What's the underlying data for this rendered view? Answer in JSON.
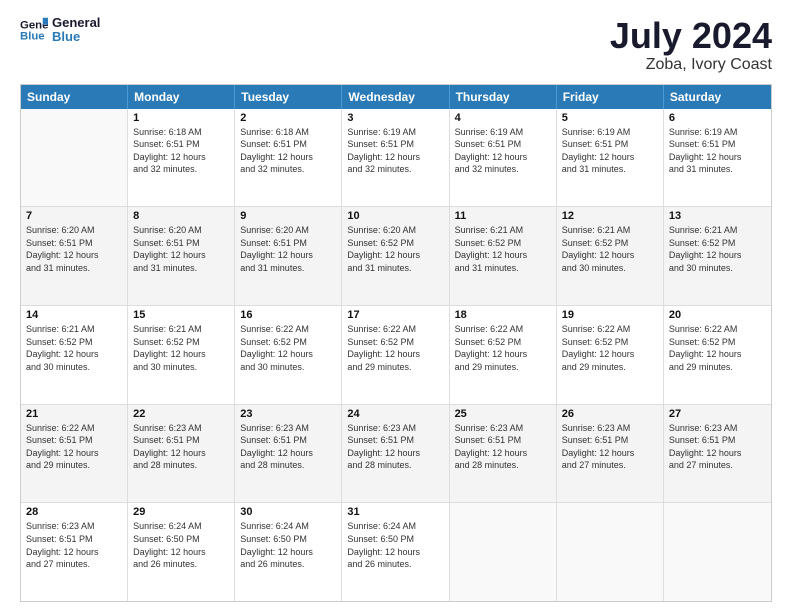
{
  "logo": {
    "line1": "General",
    "line2": "Blue"
  },
  "title": "July 2024",
  "subtitle": "Zoba, Ivory Coast",
  "header_days": [
    "Sunday",
    "Monday",
    "Tuesday",
    "Wednesday",
    "Thursday",
    "Friday",
    "Saturday"
  ],
  "weeks": [
    [
      {
        "day": "",
        "info": "",
        "empty": true
      },
      {
        "day": "1",
        "info": "Sunrise: 6:18 AM\nSunset: 6:51 PM\nDaylight: 12 hours\nand 32 minutes."
      },
      {
        "day": "2",
        "info": "Sunrise: 6:18 AM\nSunset: 6:51 PM\nDaylight: 12 hours\nand 32 minutes."
      },
      {
        "day": "3",
        "info": "Sunrise: 6:19 AM\nSunset: 6:51 PM\nDaylight: 12 hours\nand 32 minutes."
      },
      {
        "day": "4",
        "info": "Sunrise: 6:19 AM\nSunset: 6:51 PM\nDaylight: 12 hours\nand 32 minutes."
      },
      {
        "day": "5",
        "info": "Sunrise: 6:19 AM\nSunset: 6:51 PM\nDaylight: 12 hours\nand 31 minutes."
      },
      {
        "day": "6",
        "info": "Sunrise: 6:19 AM\nSunset: 6:51 PM\nDaylight: 12 hours\nand 31 minutes."
      }
    ],
    [
      {
        "day": "7",
        "info": "Sunrise: 6:20 AM\nSunset: 6:51 PM\nDaylight: 12 hours\nand 31 minutes."
      },
      {
        "day": "8",
        "info": "Sunrise: 6:20 AM\nSunset: 6:51 PM\nDaylight: 12 hours\nand 31 minutes."
      },
      {
        "day": "9",
        "info": "Sunrise: 6:20 AM\nSunset: 6:51 PM\nDaylight: 12 hours\nand 31 minutes."
      },
      {
        "day": "10",
        "info": "Sunrise: 6:20 AM\nSunset: 6:52 PM\nDaylight: 12 hours\nand 31 minutes."
      },
      {
        "day": "11",
        "info": "Sunrise: 6:21 AM\nSunset: 6:52 PM\nDaylight: 12 hours\nand 31 minutes."
      },
      {
        "day": "12",
        "info": "Sunrise: 6:21 AM\nSunset: 6:52 PM\nDaylight: 12 hours\nand 30 minutes."
      },
      {
        "day": "13",
        "info": "Sunrise: 6:21 AM\nSunset: 6:52 PM\nDaylight: 12 hours\nand 30 minutes."
      }
    ],
    [
      {
        "day": "14",
        "info": "Sunrise: 6:21 AM\nSunset: 6:52 PM\nDaylight: 12 hours\nand 30 minutes."
      },
      {
        "day": "15",
        "info": "Sunrise: 6:21 AM\nSunset: 6:52 PM\nDaylight: 12 hours\nand 30 minutes."
      },
      {
        "day": "16",
        "info": "Sunrise: 6:22 AM\nSunset: 6:52 PM\nDaylight: 12 hours\nand 30 minutes."
      },
      {
        "day": "17",
        "info": "Sunrise: 6:22 AM\nSunset: 6:52 PM\nDaylight: 12 hours\nand 29 minutes."
      },
      {
        "day": "18",
        "info": "Sunrise: 6:22 AM\nSunset: 6:52 PM\nDaylight: 12 hours\nand 29 minutes."
      },
      {
        "day": "19",
        "info": "Sunrise: 6:22 AM\nSunset: 6:52 PM\nDaylight: 12 hours\nand 29 minutes."
      },
      {
        "day": "20",
        "info": "Sunrise: 6:22 AM\nSunset: 6:52 PM\nDaylight: 12 hours\nand 29 minutes."
      }
    ],
    [
      {
        "day": "21",
        "info": "Sunrise: 6:22 AM\nSunset: 6:51 PM\nDaylight: 12 hours\nand 29 minutes."
      },
      {
        "day": "22",
        "info": "Sunrise: 6:23 AM\nSunset: 6:51 PM\nDaylight: 12 hours\nand 28 minutes."
      },
      {
        "day": "23",
        "info": "Sunrise: 6:23 AM\nSunset: 6:51 PM\nDaylight: 12 hours\nand 28 minutes."
      },
      {
        "day": "24",
        "info": "Sunrise: 6:23 AM\nSunset: 6:51 PM\nDaylight: 12 hours\nand 28 minutes."
      },
      {
        "day": "25",
        "info": "Sunrise: 6:23 AM\nSunset: 6:51 PM\nDaylight: 12 hours\nand 28 minutes."
      },
      {
        "day": "26",
        "info": "Sunrise: 6:23 AM\nSunset: 6:51 PM\nDaylight: 12 hours\nand 27 minutes."
      },
      {
        "day": "27",
        "info": "Sunrise: 6:23 AM\nSunset: 6:51 PM\nDaylight: 12 hours\nand 27 minutes."
      }
    ],
    [
      {
        "day": "28",
        "info": "Sunrise: 6:23 AM\nSunset: 6:51 PM\nDaylight: 12 hours\nand 27 minutes."
      },
      {
        "day": "29",
        "info": "Sunrise: 6:24 AM\nSunset: 6:50 PM\nDaylight: 12 hours\nand 26 minutes."
      },
      {
        "day": "30",
        "info": "Sunrise: 6:24 AM\nSunset: 6:50 PM\nDaylight: 12 hours\nand 26 minutes."
      },
      {
        "day": "31",
        "info": "Sunrise: 6:24 AM\nSunset: 6:50 PM\nDaylight: 12 hours\nand 26 minutes."
      },
      {
        "day": "",
        "info": "",
        "empty": true
      },
      {
        "day": "",
        "info": "",
        "empty": true
      },
      {
        "day": "",
        "info": "",
        "empty": true
      }
    ]
  ]
}
